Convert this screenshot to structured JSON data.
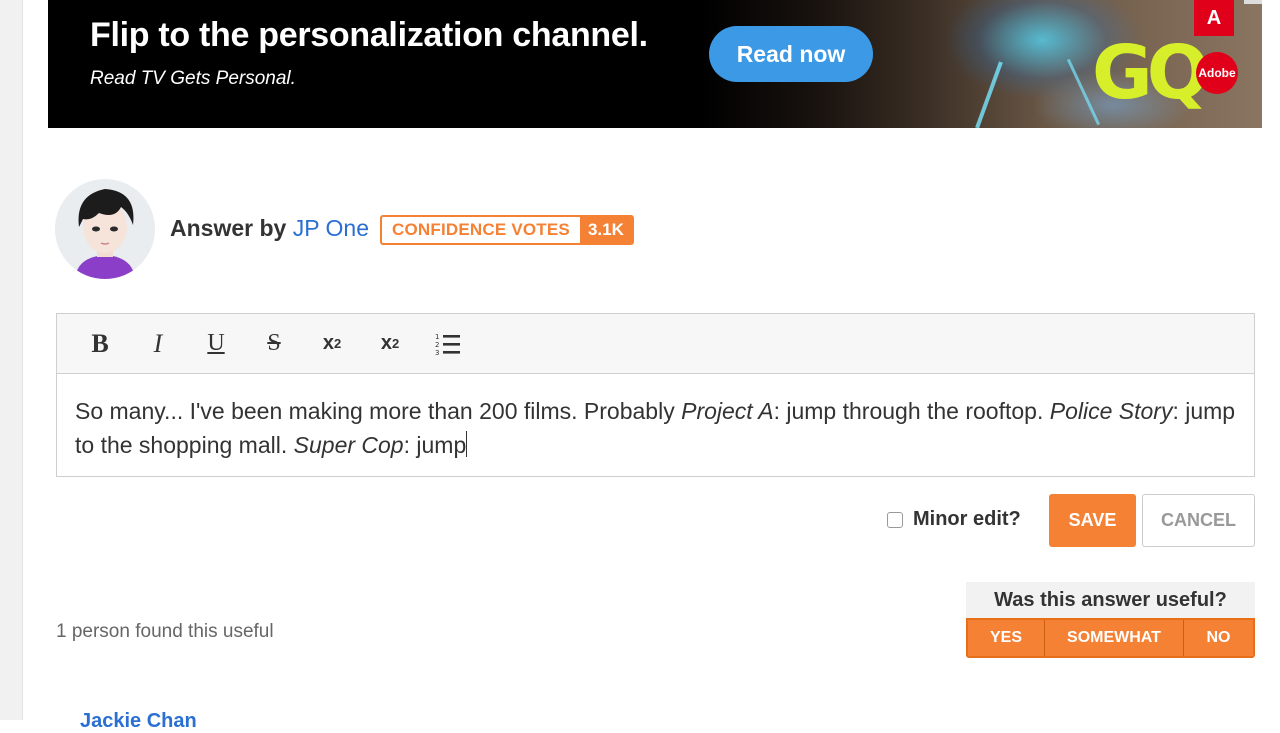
{
  "ad": {
    "headline": "Flip to the personalization channel.",
    "subline": "Read TV Gets Personal.",
    "cta_label": "Read now",
    "brand_logo": "GQ",
    "sponsor_mark": "A",
    "sponsor_badge": "Adobe",
    "accent_color": "#3c99e6"
  },
  "answer": {
    "by_label": "Answer by",
    "author": "JP One",
    "confidence_label": "CONFIDENCE VOTES",
    "confidence_count": "3.1K",
    "avatar_icon": "user-avatar"
  },
  "editor": {
    "toolbar": {
      "bold": "B",
      "italic": "I",
      "underline": "U",
      "strikethrough": "S",
      "subscript": "x",
      "subscript_mark": "2",
      "superscript": "x",
      "superscript_mark": "2",
      "list_icon": "ordered-list-icon"
    },
    "segments": [
      {
        "text": "So many... I've been making more than 200 films. Probably ",
        "italic": false
      },
      {
        "text": "Project A",
        "italic": true
      },
      {
        "text": ": jump through the rooftop. ",
        "italic": false
      },
      {
        "text": "Police Story",
        "italic": true
      },
      {
        "text": ": jump to the shopping mall. ",
        "italic": false
      },
      {
        "text": "Super Cop",
        "italic": true
      },
      {
        "text": ": jump",
        "italic": false
      }
    ]
  },
  "actions": {
    "minor_edit_label": "Minor edit?",
    "minor_edit_checked": false,
    "save_label": "SAVE",
    "cancel_label": "CANCEL",
    "accent_color": "#f58134"
  },
  "useful": {
    "count_text": "1 person found this useful",
    "question": "Was this answer useful?",
    "yes_label": "YES",
    "somewhat_label": "SOMEWHAT",
    "no_label": "NO"
  },
  "footer": {
    "link_text": "Jackie Chan"
  }
}
